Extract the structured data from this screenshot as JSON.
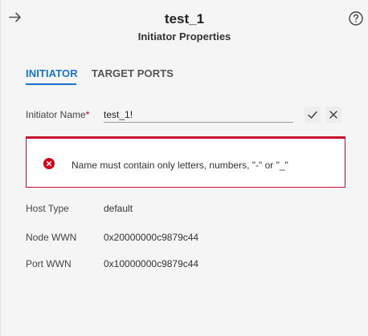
{
  "header": {
    "title": "test_1",
    "subtitle": "Initiator Properties"
  },
  "tabs": [
    {
      "label": "INITIATOR",
      "active": true
    },
    {
      "label": "TARGET PORTS",
      "active": false
    }
  ],
  "form": {
    "initiator_name_label": "Initiator Name",
    "required_mark": "*",
    "initiator_name_value": "test_1!"
  },
  "error": {
    "message": "Name must contain only letters, numbers, \"-\" or \"_\""
  },
  "properties": {
    "host_type_label": "Host Type",
    "host_type_value": "default",
    "node_wwn_label": "Node WWN",
    "node_wwn_value": "0x20000000c9879c44",
    "port_wwn_label": "Port WWN",
    "port_wwn_value": "0x10000000c9879c44"
  },
  "colors": {
    "accent": "#1a73c9",
    "error": "#c8102e"
  },
  "icons": {
    "back": "arrow-right-icon",
    "help": "help-circle-icon",
    "confirm": "check-icon",
    "cancel": "close-icon",
    "error": "error-circle-icon"
  }
}
